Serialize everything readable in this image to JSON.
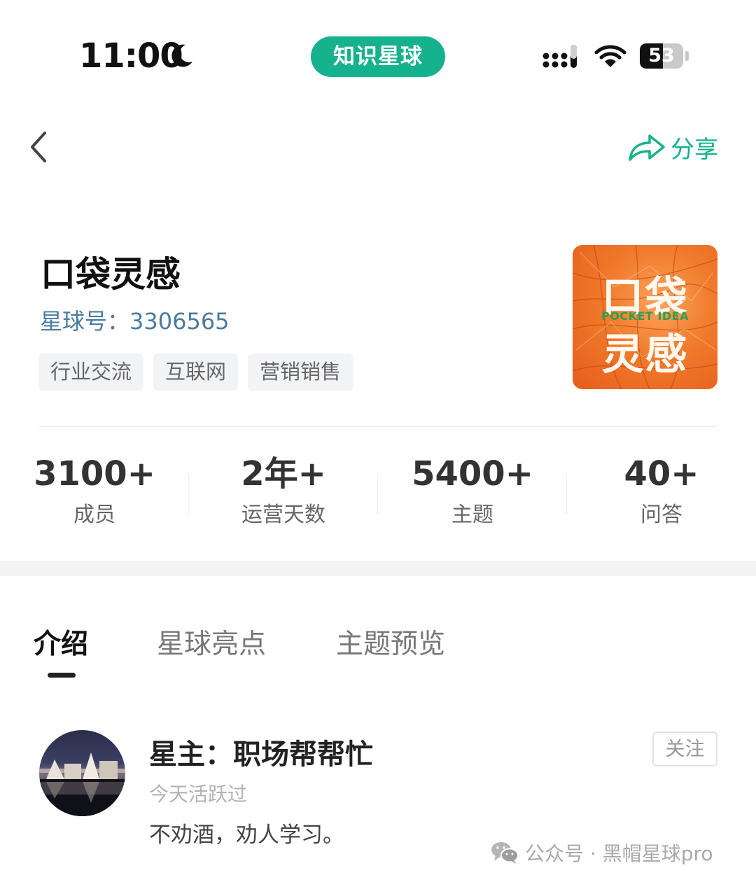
{
  "status_bar": {
    "time": "11:00",
    "app_name": "知识星球",
    "battery_percent": "53",
    "battery_level": 0.53,
    "icons": [
      "moon-icon",
      "cellular-signal-icon",
      "wifi-icon",
      "battery-icon"
    ]
  },
  "nav": {
    "back_icon": "chevron-left-icon",
    "share_label": "分享",
    "share_icon": "share-arrow-icon",
    "accent_color": "#16b28e"
  },
  "group": {
    "name": "口袋灵感",
    "id_label": "星球号：",
    "id_value": "3306565",
    "tags": [
      "行业交流",
      "互联网",
      "营销销售"
    ],
    "cover": {
      "line1": "口袋",
      "english": "POCKET IDEA",
      "line2": "灵感"
    }
  },
  "stats": [
    {
      "value": "3100+",
      "label": "成员"
    },
    {
      "value": "2年+",
      "label": "运营天数"
    },
    {
      "value": "5400+",
      "label": "主题"
    },
    {
      "value": "40+",
      "label": "问答"
    }
  ],
  "tabs": [
    {
      "label": "介绍",
      "active": true
    },
    {
      "label": "星球亮点",
      "active": false
    },
    {
      "label": "主题预览",
      "active": false
    }
  ],
  "owner": {
    "title": "星主：职场帮帮忙",
    "active_status": "今天活跃过",
    "bio": "不劝酒，劝人学习。",
    "follow_label": "关注"
  },
  "watermark": {
    "text": "公众号 · 黑帽星球pro",
    "icon": "wechat-icon"
  }
}
